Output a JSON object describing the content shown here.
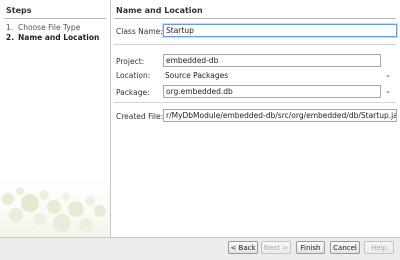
{
  "steps": {
    "title": "Steps",
    "items": [
      {
        "num": "1.",
        "label": "Choose File Type"
      },
      {
        "num": "2.",
        "label": "Name and Location"
      }
    ]
  },
  "panel": {
    "title": "Name and Location",
    "class_name_label": "Class Name:",
    "class_name_value": "Startup",
    "project_label": "Project:",
    "project_value": "embedded-db",
    "location_label": "Location:",
    "location_value": "Source Packages",
    "package_label": "Package:",
    "package_value": "org.embedded.db",
    "created_file_label": "Created File:",
    "created_file_value": "r/MyDbModule/embedded-db/src/org/embedded/db/Startup.java"
  },
  "buttons": {
    "back": "< Back",
    "next": "Next >",
    "finish": "Finish",
    "cancel": "Cancel",
    "help": "Help"
  },
  "icons": {
    "dropdown": "chevron-down-icon"
  }
}
